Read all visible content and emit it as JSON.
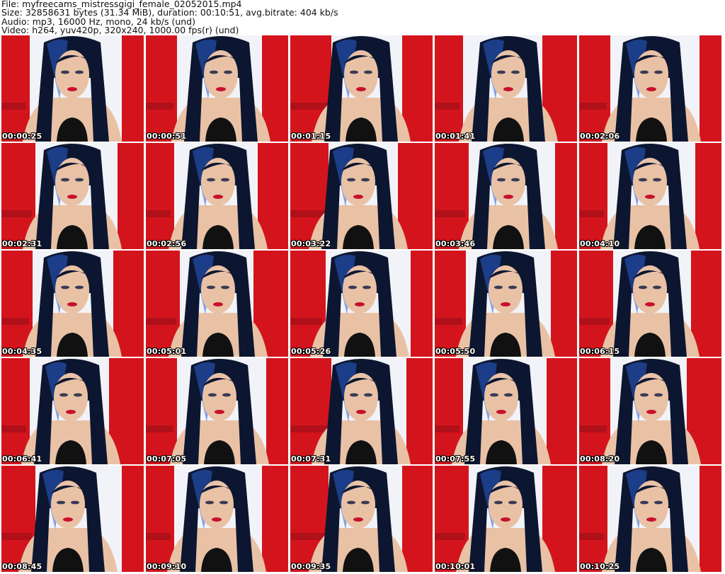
{
  "header": {
    "file": "File: myfreecams_mistressgigi_female_02052015.mp4",
    "size": "Size: 32858631 bytes (31.34 MiB), duration: 00:10:51, avg.bitrate: 404 kb/s",
    "audio": "Audio: mp3, 16000 Hz, mono, 24 kb/s (und)",
    "video": "Video: h264, yuv420p, 320x240, 1000.00 fps(r) (und)"
  },
  "colors": {
    "curtain": "#d4141c",
    "wall": "#f2f3f8",
    "hair": "#0d1630",
    "hair_highlight": "#2a5fd0",
    "skin": "#e9c2a6",
    "top": "#111111"
  },
  "thumbnails": [
    {
      "timestamp": "00:00:25"
    },
    {
      "timestamp": "00:00:51"
    },
    {
      "timestamp": "00:01:15"
    },
    {
      "timestamp": "00:01:41"
    },
    {
      "timestamp": "00:02:06"
    },
    {
      "timestamp": "00:02:31"
    },
    {
      "timestamp": "00:02:56"
    },
    {
      "timestamp": "00:03:22"
    },
    {
      "timestamp": "00:03:46"
    },
    {
      "timestamp": "00:04:10"
    },
    {
      "timestamp": "00:04:35"
    },
    {
      "timestamp": "00:05:01"
    },
    {
      "timestamp": "00:05:26"
    },
    {
      "timestamp": "00:05:50"
    },
    {
      "timestamp": "00:06:15"
    },
    {
      "timestamp": "00:06:41"
    },
    {
      "timestamp": "00:07:05"
    },
    {
      "timestamp": "00:07:31"
    },
    {
      "timestamp": "00:07:55"
    },
    {
      "timestamp": "00:08:20"
    },
    {
      "timestamp": "00:08:45"
    },
    {
      "timestamp": "00:09:10"
    },
    {
      "timestamp": "00:09:35"
    },
    {
      "timestamp": "00:10:01"
    },
    {
      "timestamp": "00:10:25"
    }
  ]
}
